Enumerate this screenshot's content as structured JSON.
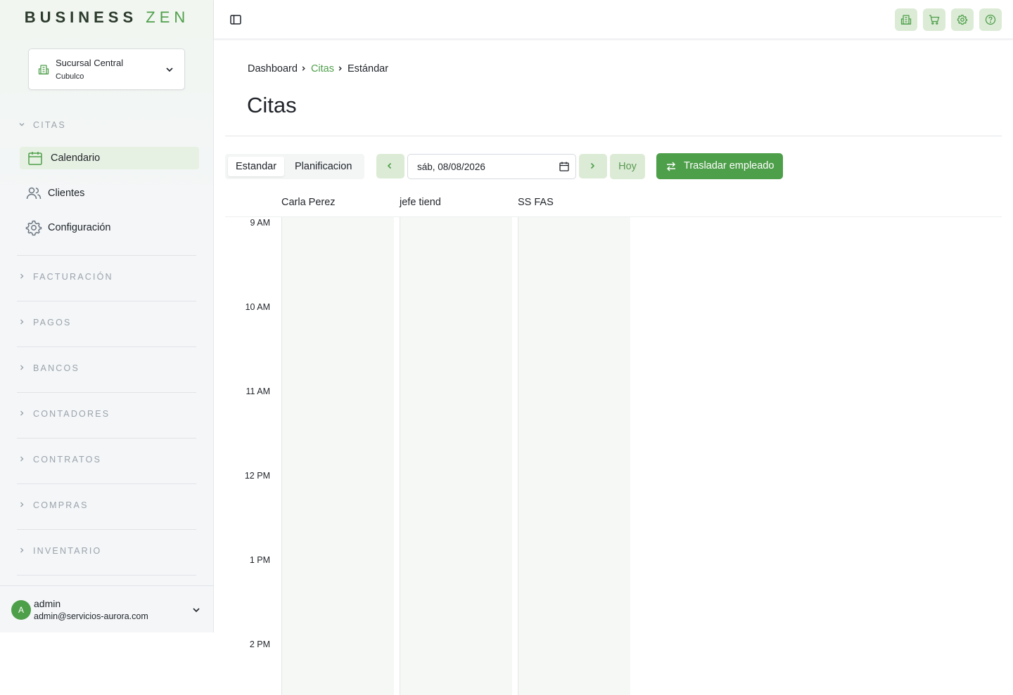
{
  "app": {
    "logo_part1": "BUSINESS",
    "logo_part2": "ZEN"
  },
  "branch": {
    "name": "Sucursal Central",
    "sub": "Cubulco"
  },
  "sidebar": {
    "citas_header": "CITAS",
    "items": [
      {
        "label": "Calendario",
        "icon": "calendar-icon",
        "active": true
      },
      {
        "label": "Clientes",
        "icon": "users-icon",
        "active": false
      },
      {
        "label": "Configuración",
        "icon": "gear-icon",
        "active": false
      }
    ],
    "sections": [
      "FACTURACIÓN",
      "PAGOS",
      "BANCOS",
      "CONTADORES",
      "CONTRATOS",
      "COMPRAS",
      "INVENTARIO"
    ]
  },
  "user": {
    "avatar_letter": "A",
    "name": "admin",
    "email": "admin@servicios-aurora.com"
  },
  "breadcrumb": {
    "items": [
      "Dashboard",
      "Citas",
      "Estándar"
    ]
  },
  "page": {
    "title": "Citas"
  },
  "toolbar": {
    "view_options": [
      "Estandar",
      "Planificacion"
    ],
    "selected_view": "Estandar",
    "date_value": "sáb, 08/08/2026",
    "today_label": "Hoy",
    "transfer_label": "Trasladar empleado"
  },
  "calendar": {
    "employees": [
      "Carla Perez",
      "jefe tiend",
      "SS FAS"
    ],
    "time_slots": [
      "9 AM",
      "10 AM",
      "11 AM",
      "12 PM",
      "1 PM",
      "2 PM"
    ]
  },
  "colors": {
    "accent": "#4e9f4a",
    "accent_light": "#dcebd6",
    "active_nav_bg": "#e7f1e3"
  }
}
